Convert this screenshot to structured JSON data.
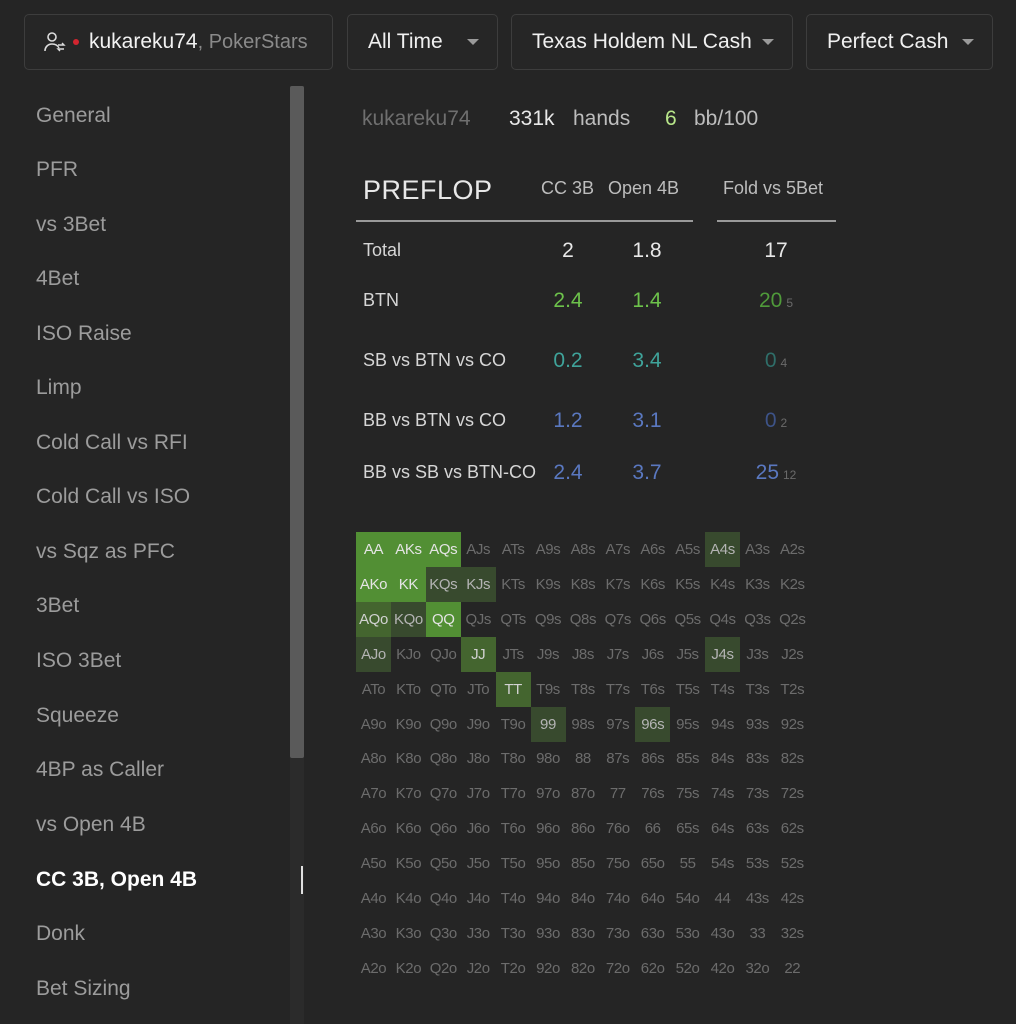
{
  "topbar": {
    "player_name": "kukareku74",
    "player_site": ", PokerStars",
    "time_filter": "All Time",
    "game_filter": "Texas Holdem NL Cash",
    "pool_filter": "Perfect Cash"
  },
  "sidebar": {
    "items": [
      {
        "label": "General"
      },
      {
        "label": "PFR"
      },
      {
        "label": "vs 3Bet"
      },
      {
        "label": "4Bet"
      },
      {
        "label": "ISO Raise"
      },
      {
        "label": "Limp"
      },
      {
        "label": "Cold Call vs RFI"
      },
      {
        "label": "Cold Call vs ISO"
      },
      {
        "label": "vs Sqz as PFC"
      },
      {
        "label": "3Bet"
      },
      {
        "label": "ISO 3Bet"
      },
      {
        "label": "Squeeze"
      },
      {
        "label": "4BP as Caller"
      },
      {
        "label": "vs Open 4B"
      },
      {
        "label": "CC 3B, Open 4B",
        "active": true
      },
      {
        "label": "Donk"
      },
      {
        "label": "Bet Sizing"
      }
    ]
  },
  "stats": {
    "name": "kukareku74",
    "hands_value": "331k",
    "hands_label": "hands",
    "bb_value": "6",
    "bb_label": "bb/100"
  },
  "preflop": {
    "title": "PREFLOP",
    "columns": [
      "CC 3B",
      "Open 4B",
      "Fold vs 5Bet"
    ],
    "rows": [
      {
        "label": "Total",
        "cc3b": "2",
        "open4b": "1.8",
        "fold5b": "17",
        "fold5b_n": "",
        "color": "#e8e8e8"
      },
      {
        "label": "BTN",
        "cc3b": "2.4",
        "open4b": "1.4",
        "fold5b": "20",
        "fold5b_n": "5",
        "color": "#6dc24b",
        "fold_color": "#4f9a3a"
      },
      {
        "label": "SB vs BTN vs CO",
        "cc3b": "0.2",
        "open4b": "3.4",
        "fold5b": "0",
        "fold5b_n": "4",
        "color": "#3fa39a",
        "fold_color": "#2f6e69"
      },
      {
        "label": "BB vs BTN vs CO",
        "cc3b": "1.2",
        "open4b": "3.1",
        "fold5b": "0",
        "fold5b_n": "2",
        "color": "#5a78c0",
        "fold_color": "#3d5388"
      },
      {
        "label": "BB vs SB vs BTN-CO",
        "cc3b": "2.4",
        "open4b": "3.7",
        "fold5b": "25",
        "fold5b_n": "12",
        "color": "#5a78c0",
        "fold_color": "#5a78c0"
      }
    ]
  },
  "hand_grid": {
    "ranks": [
      "A",
      "K",
      "Q",
      "J",
      "T",
      "9",
      "8",
      "7",
      "6",
      "5",
      "4",
      "3",
      "2"
    ],
    "highlighted": {
      "AA": 3,
      "AKs": 3,
      "AQs": 3,
      "A4s": 1,
      "AKo": 3,
      "KK": 3,
      "KQs": 1,
      "KJs": 1,
      "AQo": 2,
      "KQo": 1,
      "QQ": 3,
      "AJo": 1,
      "JJ": 2,
      "J4s": 1,
      "TT": 2,
      "99": 1,
      "96s": 1
    },
    "colors": {
      "lvl1": "#384a2e",
      "lvl2": "#44652f",
      "lvl3": "#528f34"
    }
  }
}
